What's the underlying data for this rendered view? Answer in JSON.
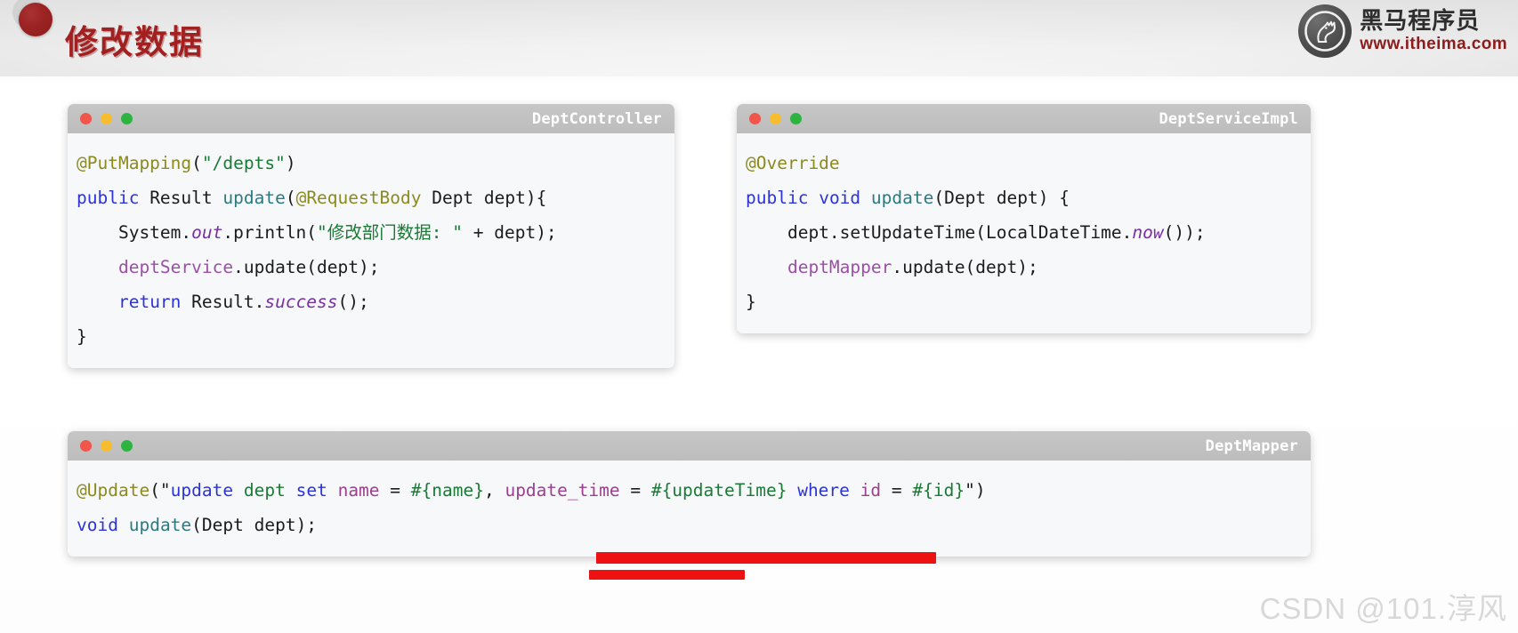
{
  "slide": {
    "title": "修改数据",
    "watermark": "CSDN @101.淳风"
  },
  "logo": {
    "icon": "horse-head-icon",
    "brand_cn": "黑马程序员",
    "url": "www.itheima.com"
  },
  "windows": {
    "controller": {
      "title": "DeptController",
      "lights": {
        "close": "close-light",
        "minimize": "minimize-light",
        "maximize": "maximize-light"
      },
      "lines": [
        [
          {
            "t": "@PutMapping",
            "c": "ann"
          },
          {
            "t": "(",
            "c": "plain"
          },
          {
            "t": "\"/depts\"",
            "c": "str"
          },
          {
            "t": ")",
            "c": "plain"
          }
        ],
        [
          {
            "t": "public",
            "c": "kw"
          },
          {
            "t": " Result ",
            "c": "plain"
          },
          {
            "t": "update",
            "c": "meth"
          },
          {
            "t": "(",
            "c": "plain"
          },
          {
            "t": "@RequestBody",
            "c": "ann"
          },
          {
            "t": " Dept dept){",
            "c": "plain"
          }
        ],
        [
          {
            "t": "    System.",
            "c": "plain"
          },
          {
            "t": "out",
            "c": "stat"
          },
          {
            "t": ".println(",
            "c": "plain"
          },
          {
            "t": "\"修改部门数据: \"",
            "c": "str"
          },
          {
            "t": " + dept);",
            "c": "plain"
          }
        ],
        [
          {
            "t": "    ",
            "c": "plain"
          },
          {
            "t": "deptService",
            "c": "fld"
          },
          {
            "t": ".update(dept);",
            "c": "plain"
          }
        ],
        [
          {
            "t": "    ",
            "c": "plain"
          },
          {
            "t": "return",
            "c": "kw"
          },
          {
            "t": " Result.",
            "c": "plain"
          },
          {
            "t": "success",
            "c": "stat"
          },
          {
            "t": "();",
            "c": "plain"
          }
        ],
        [
          {
            "t": "}",
            "c": "plain"
          }
        ]
      ]
    },
    "service": {
      "title": "DeptServiceImpl",
      "lights": {
        "close": "close-light",
        "minimize": "minimize-light",
        "maximize": "maximize-light"
      },
      "lines": [
        [
          {
            "t": "@Override",
            "c": "ann"
          }
        ],
        [
          {
            "t": "public",
            "c": "kw"
          },
          {
            "t": " ",
            "c": "plain"
          },
          {
            "t": "void",
            "c": "kw"
          },
          {
            "t": " ",
            "c": "plain"
          },
          {
            "t": "update",
            "c": "meth"
          },
          {
            "t": "(Dept dept) {",
            "c": "plain"
          }
        ],
        [
          {
            "t": "    dept.setUpdateTime(LocalDateTime.",
            "c": "plain"
          },
          {
            "t": "now",
            "c": "stat"
          },
          {
            "t": "());",
            "c": "plain"
          }
        ],
        [
          {
            "t": "    ",
            "c": "plain"
          },
          {
            "t": "deptMapper",
            "c": "fld"
          },
          {
            "t": ".update(dept);",
            "c": "plain"
          }
        ],
        [
          {
            "t": "}",
            "c": "plain"
          }
        ]
      ]
    },
    "mapper": {
      "title": "DeptMapper",
      "lights": {
        "close": "close-light",
        "minimize": "minimize-light",
        "maximize": "maximize-light"
      },
      "lines": [
        [
          {
            "t": "@Update",
            "c": "ann"
          },
          {
            "t": "(\"",
            "c": "plain"
          },
          {
            "t": "update",
            "c": "kw"
          },
          {
            "t": " ",
            "c": "plain"
          },
          {
            "t": "dept",
            "c": "sqltbl"
          },
          {
            "t": " ",
            "c": "plain"
          },
          {
            "t": "set",
            "c": "kw"
          },
          {
            "t": " ",
            "c": "plain"
          },
          {
            "t": "name",
            "c": "sqlid"
          },
          {
            "t": " = ",
            "c": "plain"
          },
          {
            "t": "#{name}",
            "c": "sqlparam"
          },
          {
            "t": ", ",
            "c": "plain"
          },
          {
            "t": "update_time",
            "c": "sqlid"
          },
          {
            "t": " = ",
            "c": "plain"
          },
          {
            "t": "#{updateTime}",
            "c": "sqlparam"
          },
          {
            "t": " ",
            "c": "plain"
          },
          {
            "t": "where",
            "c": "kw"
          },
          {
            "t": " ",
            "c": "plain"
          },
          {
            "t": "id",
            "c": "sqlid"
          },
          {
            "t": " = ",
            "c": "plain"
          },
          {
            "t": "#{id}",
            "c": "sqlparam"
          },
          {
            "t": "\")",
            "c": "plain"
          }
        ],
        [
          {
            "t": "void",
            "c": "kw"
          },
          {
            "t": " ",
            "c": "plain"
          },
          {
            "t": "update",
            "c": "meth"
          },
          {
            "t": "(Dept dept);",
            "c": "plain"
          }
        ]
      ]
    }
  },
  "annotations": {
    "color": "#ee1111",
    "bars": [
      {
        "name": "redbar-updatetime-col",
        "target": "update_time = #{updateTime}"
      },
      {
        "name": "redbar-updatetime-sub",
        "target": "update_time"
      }
    ]
  }
}
